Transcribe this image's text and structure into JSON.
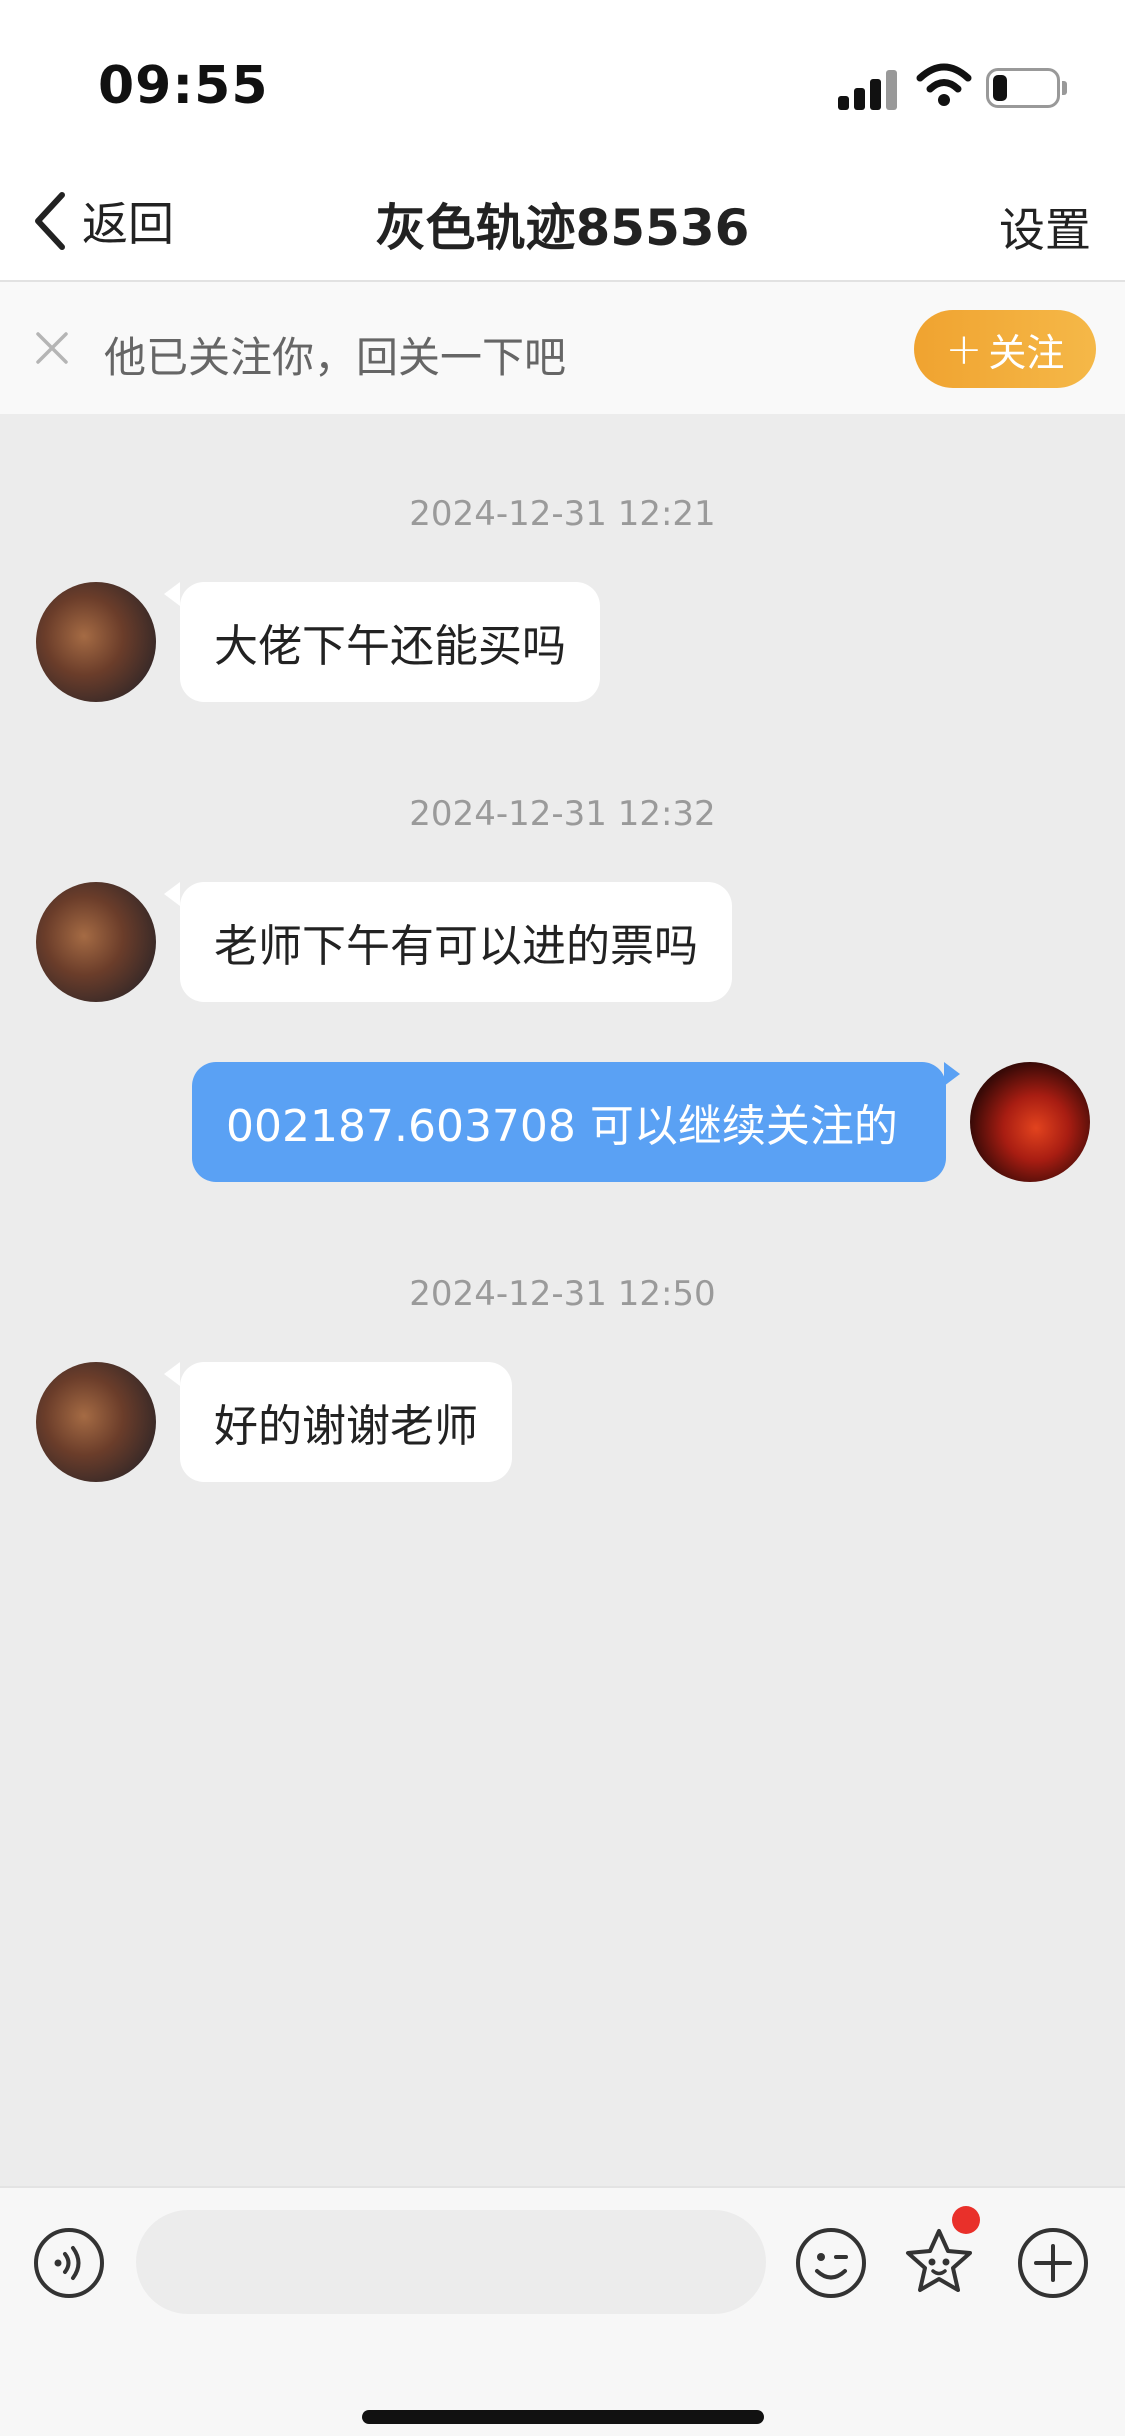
{
  "status_bar": {
    "time": "09:55"
  },
  "nav": {
    "back_label": "返回",
    "title": "灰色轨迹85536",
    "settings_label": "设置"
  },
  "follow_banner": {
    "text": "他已关注你，回关一下吧",
    "button_label": "关注",
    "button_color": "#f0a330"
  },
  "chat": {
    "timestamps": [
      "2024-12-31 12:21",
      "2024-12-31 12:32",
      "2024-12-31 12:50"
    ],
    "messages": [
      {
        "sender": "other",
        "text": "大佬下午还能买吗"
      },
      {
        "sender": "other",
        "text": "老师下午有可以进的票吗"
      },
      {
        "sender": "me",
        "text": "002187.603708 可以继续关注的"
      },
      {
        "sender": "other",
        "text": "好的谢谢老师"
      }
    ],
    "outgoing_color": "#5aa1f4"
  },
  "input_bar": {
    "input_value": "",
    "icons": [
      "voice-icon",
      "emoji-icon",
      "sticker-icon",
      "add-icon"
    ],
    "badge_color": "#e9302a"
  }
}
